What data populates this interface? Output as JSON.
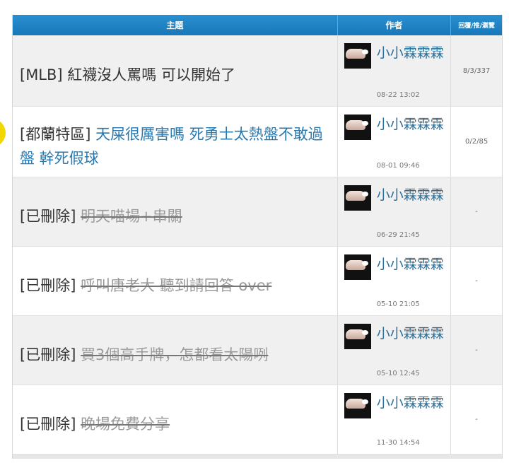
{
  "header": {
    "subject": "主題",
    "author": "作者",
    "stats": "回覆/推/瀏覽"
  },
  "rows": [
    {
      "tag": "[MLB] ",
      "title": "紅襪沒人罵嗎 可以開始了",
      "style": "plain",
      "author": "小小霖霖霖",
      "date": "08-22 13:02",
      "stats": "8/3/337"
    },
    {
      "tag": "[都蘭特區] ",
      "title": "天屎很厲害嗎 死勇士太熱盤不敢過盤 幹死假球",
      "style": "link",
      "author": "小小霖霖霖",
      "date": "08-01 09:46",
      "stats": "0/2/85"
    },
    {
      "tag": "[已刪除] ",
      "title": "明天喵場+串關",
      "style": "deleted",
      "author": "小小霖霖霖",
      "date": "06-29 21:45",
      "stats": "-"
    },
    {
      "tag": "[已刪除] ",
      "title": "呼叫唐老大 聽到請回答 over",
      "style": "deleted",
      "author": "小小霖霖霖",
      "date": "05-10 21:05",
      "stats": "-"
    },
    {
      "tag": "[已刪除] ",
      "title": "買3個高手牌，怎都看太陽咧",
      "style": "deleted",
      "author": "小小霖霖霖",
      "date": "05-10 12:45",
      "stats": "-"
    },
    {
      "tag": "[已刪除] ",
      "title": "晚場免費分享",
      "style": "deleted",
      "author": "小小霖霖霖",
      "date": "11-30 14:54",
      "stats": "-"
    }
  ]
}
